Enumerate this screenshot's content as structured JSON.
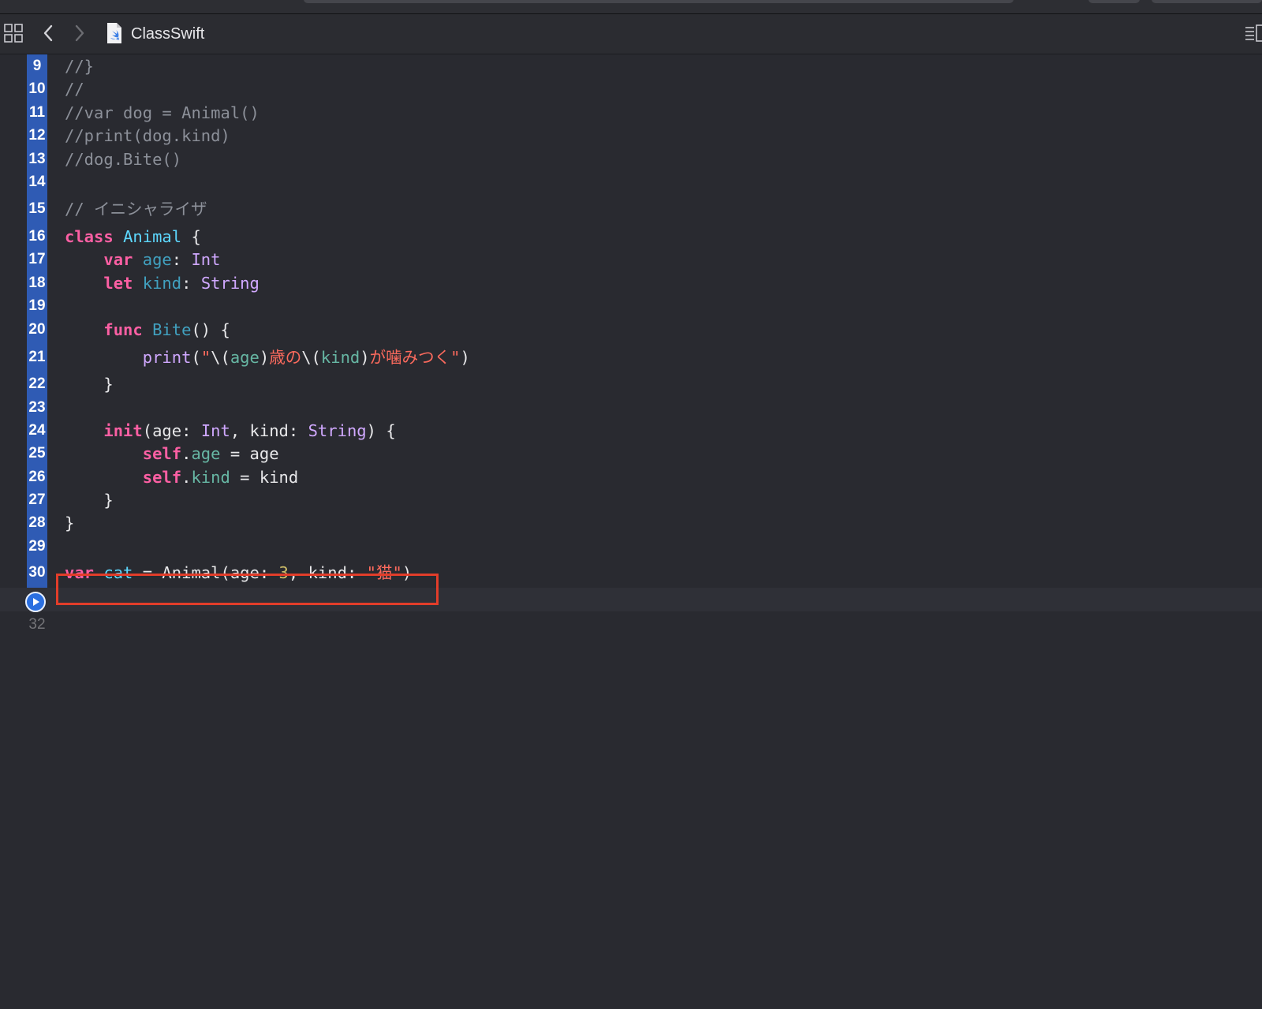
{
  "toolbar": {
    "file_name": "ClassSwift",
    "icons": [
      "grid-icon",
      "chevron-left-icon",
      "chevron-right-icon",
      "swift-file-icon",
      "inspector-icon"
    ]
  },
  "colors": {
    "background": "#292a30",
    "gutter_band": "#2f5bb4",
    "keyword": "#fc5fa3",
    "type": "#d0a8ff",
    "string": "#fc6a5d",
    "comment": "#8c9099",
    "number": "#d0bf69",
    "highlight_box": "#e23d2a",
    "run_button": "#2b6fe0"
  },
  "editor": {
    "lines": [
      {
        "number": "9",
        "tokens": [
          {
            "c": "cmt",
            "t": "//}"
          }
        ]
      },
      {
        "number": "10",
        "tokens": [
          {
            "c": "cmt",
            "t": "//"
          }
        ]
      },
      {
        "number": "11",
        "tokens": [
          {
            "c": "cmt",
            "t": "//var dog = Animal()"
          }
        ]
      },
      {
        "number": "12",
        "tokens": [
          {
            "c": "cmt",
            "t": "//print(dog.kind)"
          }
        ]
      },
      {
        "number": "13",
        "tokens": [
          {
            "c": "cmt",
            "t": "//dog.Bite()"
          }
        ]
      },
      {
        "number": "14",
        "tokens": []
      },
      {
        "number": "15",
        "tokens": [
          {
            "c": "cmt",
            "t": "// イニシャライザ"
          }
        ]
      },
      {
        "number": "16",
        "tokens": [
          {
            "c": "kw",
            "t": "class"
          },
          {
            "c": "plain",
            "t": " "
          },
          {
            "c": "decl",
            "t": "Animal"
          },
          {
            "c": "plain",
            "t": " {"
          }
        ]
      },
      {
        "number": "17",
        "tokens": [
          {
            "c": "plain",
            "t": "    "
          },
          {
            "c": "kw",
            "t": "var"
          },
          {
            "c": "plain",
            "t": " "
          },
          {
            "c": "func",
            "t": "age"
          },
          {
            "c": "plain",
            "t": ": "
          },
          {
            "c": "typ",
            "t": "Int"
          }
        ]
      },
      {
        "number": "18",
        "tokens": [
          {
            "c": "plain",
            "t": "    "
          },
          {
            "c": "kw",
            "t": "let"
          },
          {
            "c": "plain",
            "t": " "
          },
          {
            "c": "func",
            "t": "kind"
          },
          {
            "c": "plain",
            "t": ": "
          },
          {
            "c": "typ",
            "t": "String"
          }
        ]
      },
      {
        "number": "19",
        "tokens": []
      },
      {
        "number": "20",
        "tokens": [
          {
            "c": "plain",
            "t": "    "
          },
          {
            "c": "kw",
            "t": "func"
          },
          {
            "c": "plain",
            "t": " "
          },
          {
            "c": "func",
            "t": "Bite"
          },
          {
            "c": "plain",
            "t": "() {"
          }
        ]
      },
      {
        "number": "21",
        "tokens": [
          {
            "c": "plain",
            "t": "        "
          },
          {
            "c": "typ",
            "t": "print"
          },
          {
            "c": "plain",
            "t": "("
          },
          {
            "c": "str",
            "t": "\""
          },
          {
            "c": "plain",
            "t": "\\("
          },
          {
            "c": "prop",
            "t": "age"
          },
          {
            "c": "plain",
            "t": ")"
          },
          {
            "c": "str",
            "t": "歳の"
          },
          {
            "c": "plain",
            "t": "\\("
          },
          {
            "c": "prop",
            "t": "kind"
          },
          {
            "c": "plain",
            "t": ")"
          },
          {
            "c": "str",
            "t": "が噛みつく\""
          },
          {
            "c": "plain",
            "t": ")"
          }
        ]
      },
      {
        "number": "22",
        "tokens": [
          {
            "c": "plain",
            "t": "    }"
          }
        ]
      },
      {
        "number": "23",
        "tokens": []
      },
      {
        "number": "24",
        "tokens": [
          {
            "c": "plain",
            "t": "    "
          },
          {
            "c": "kw",
            "t": "init"
          },
          {
            "c": "plain",
            "t": "(age: "
          },
          {
            "c": "typ",
            "t": "Int"
          },
          {
            "c": "plain",
            "t": ", kind: "
          },
          {
            "c": "typ",
            "t": "String"
          },
          {
            "c": "plain",
            "t": ") {"
          }
        ]
      },
      {
        "number": "25",
        "tokens": [
          {
            "c": "plain",
            "t": "        "
          },
          {
            "c": "kw",
            "t": "self"
          },
          {
            "c": "plain",
            "t": "."
          },
          {
            "c": "prop",
            "t": "age"
          },
          {
            "c": "plain",
            "t": " = age"
          }
        ]
      },
      {
        "number": "26",
        "tokens": [
          {
            "c": "plain",
            "t": "        "
          },
          {
            "c": "kw",
            "t": "self"
          },
          {
            "c": "plain",
            "t": "."
          },
          {
            "c": "prop",
            "t": "kind"
          },
          {
            "c": "plain",
            "t": " = kind"
          }
        ]
      },
      {
        "number": "27",
        "tokens": [
          {
            "c": "plain",
            "t": "    }"
          }
        ]
      },
      {
        "number": "28",
        "tokens": [
          {
            "c": "plain",
            "t": "}"
          }
        ]
      },
      {
        "number": "29",
        "tokens": []
      },
      {
        "number": "30",
        "tokens": [
          {
            "c": "kw",
            "t": "var"
          },
          {
            "c": "plain",
            "t": " "
          },
          {
            "c": "decl",
            "t": "cat"
          },
          {
            "c": "plain",
            "t": " = Animal(age: "
          },
          {
            "c": "num",
            "t": "3"
          },
          {
            "c": "plain",
            "t": ", kind: "
          },
          {
            "c": "str",
            "t": "\"猫\""
          },
          {
            "c": "plain",
            "t": ")"
          }
        ]
      },
      {
        "number": "",
        "tokens": [],
        "run_button": true,
        "current": true
      },
      {
        "number": "32",
        "tokens": [],
        "dim": true
      }
    ]
  }
}
